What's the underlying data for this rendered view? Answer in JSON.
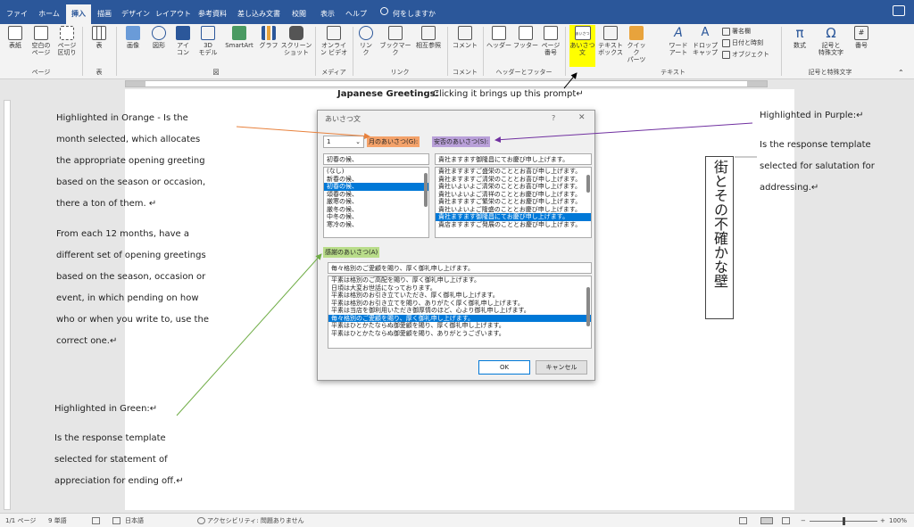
{
  "tabs": [
    "ファイル",
    "ホーム",
    "挿入",
    "描画",
    "デザイン",
    "レイアウト",
    "参考資料",
    "差し込み文書",
    "校閲",
    "表示",
    "ヘルプ"
  ],
  "active_tab": "挿入",
  "tell_me": "何をしますか",
  "ribbon": {
    "page": [
      "表紙",
      "空白の\nページ",
      "ページ\n区切り"
    ],
    "table": [
      "表"
    ],
    "illustrations": [
      "画像",
      "図形",
      "アイ\nコン",
      "3D\nモデル",
      "SmartArt",
      "グラフ",
      "スクリーン\nショット"
    ],
    "media": [
      "オンライ\nン ビデオ"
    ],
    "links": [
      "リン\nク",
      "ブックマーク",
      "相互参照"
    ],
    "comments": [
      "コメント"
    ],
    "header_footer": [
      "ヘッダー",
      "フッター",
      "ページ\n番号"
    ],
    "text": [
      "あいさつ\n文",
      "テキスト\nボックス",
      "クイック\nパーツ",
      "ワード\nアート",
      "ドロップ\nキャップ"
    ],
    "text_small": [
      "署名欄",
      "日付と時刻",
      "オブジェクト"
    ],
    "symbols": [
      "数式",
      "記号と\n特殊文字",
      "番号"
    ],
    "greeting_icon_label": "あいさつ",
    "groups": [
      "ページ",
      "表",
      "図",
      "メディア",
      "リンク",
      "コメント",
      "ヘッダーとフッター",
      "テキスト",
      "記号と特殊文字"
    ]
  },
  "caption": {
    "bold": "Japanese Greetings:",
    "rest": " Clicking it brings up this prompt↵"
  },
  "orange_note": [
    "Highlighted in Orange - Is the",
    "month selected, which allocates",
    "the appropriate opening greeting",
    "based on the season or occasion,",
    "there a ton of them. ↵"
  ],
  "month_note": [
    "From each 12 months, have a",
    "different set of opening greetings",
    "based on the season, occasion or",
    "event, in which pending on how",
    "who or when you write to, use the",
    "correct one.↵"
  ],
  "green_note": [
    "Highlighted in Green:↵",
    "Is the response template",
    "selected for statement of",
    "appreciation for ending off.↵"
  ],
  "purple_note": [
    "Highlighted in Purple:↵",
    "Is the response template",
    "selected for salutation for",
    "addressing.↵"
  ],
  "vertical_text": "街とその不確かな壁",
  "dialog": {
    "title": "あいさつ文",
    "help": "?",
    "month_value": "1",
    "month_label": "月のあいさつ(G):",
    "anpi_label": "安否のあいさつ(S):",
    "month_current": "初春の候、",
    "month_list": [
      "(なし)",
      "新春の候、",
      "初春の候、",
      "頌春の候、",
      "厳寒の候、",
      "厳冬の候、",
      "中冬の候、",
      "寒冷の候、"
    ],
    "month_selected_index": 2,
    "anpi_current": "貴社ますます御隆昌にてお慶び申し上げます。",
    "anpi_list": [
      "貴社ますますご盛栄のこととお喜び申し上げます。",
      "貴社ますますご清栄のこととお喜び申し上げます。",
      "貴社いよいよご清栄のこととお喜び申し上げます。",
      "貴社いよいよご清祥のこととお慶び申し上げます。",
      "貴社ますますご繁栄のこととお慶び申し上げます。",
      "貴社いよいよご隆盛のこととお慶び申し上げます。",
      "貴社ますます御隆昌にてお慶び申し上げます。",
      "貴店ますますご発展のこととお慶び申し上げます。"
    ],
    "anpi_selected_index": 6,
    "thanks_label": "感謝のあいさつ(A)",
    "thanks_current": "毎々格別のご愛顧を賜り、厚く御礼申し上げます。",
    "thanks_list": [
      "平素は格別のご高配を賜り、厚く御礼申し上げます。",
      "日頃は大変お世話になっております。",
      "平素は格別のお引き立ていただき、厚く御礼申し上げます。",
      "平素は格別のお引き立てを賜り、ありがたく厚く御礼申し上げます。",
      "平素は当店を御利用いただき御厚情のほど、心より御礼申し上げます。",
      "毎々格別のご愛顧を賜り、厚く御礼申し上げます。",
      "平素はひとかたならぬ御愛顧を賜り、厚く御礼申し上げます。",
      "平素はひとかたならぬ御愛顧を賜り、ありがとうございます。"
    ],
    "thanks_selected_index": 5,
    "ok": "OK",
    "cancel": "キャンセル"
  },
  "status": {
    "page": "1/1 ページ",
    "words": "9 単語",
    "lang": "日本語",
    "access": "アクセシビリティ: 問題ありません",
    "zoom": "100%"
  },
  "colors": {
    "title_bar": "#2b579a",
    "orange": "#f4a26a",
    "purple": "#b9a0d9",
    "green": "#b9dd8a",
    "yellow": "#ffff00",
    "select_blue": "#0078d7",
    "orange_arrow": "#e8813c",
    "purple_arrow": "#7030a0",
    "green_arrow": "#70ad47"
  }
}
